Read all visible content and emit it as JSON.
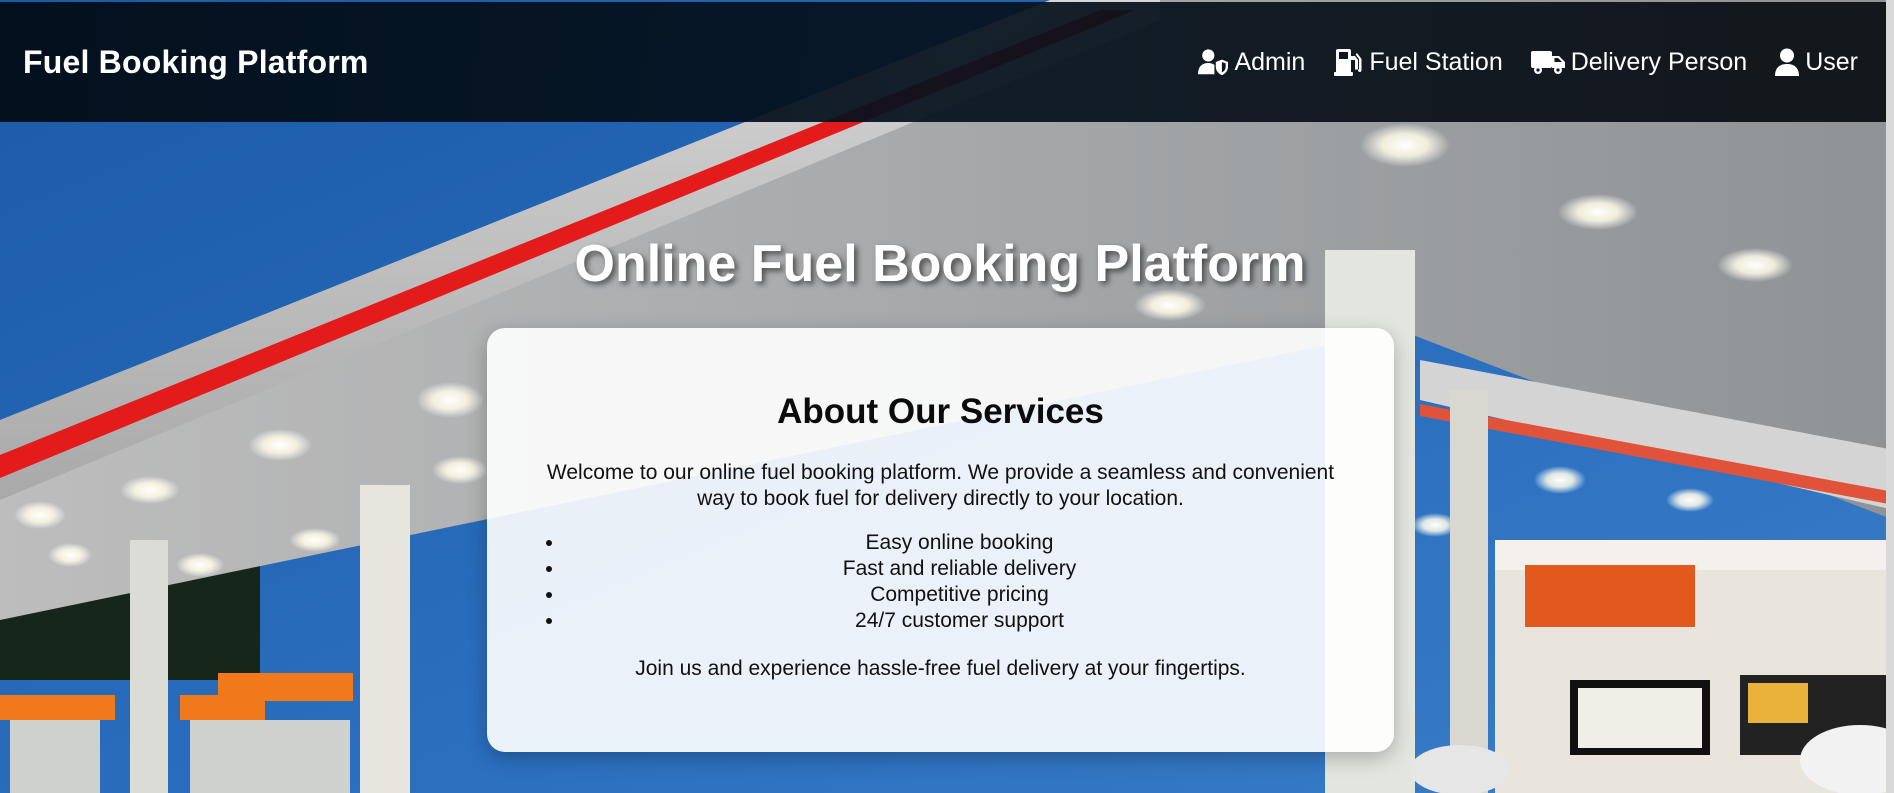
{
  "header": {
    "brand": "Fuel Booking Platform",
    "nav": [
      {
        "label": "Admin",
        "icon": "user-shield-icon"
      },
      {
        "label": "Fuel Station",
        "icon": "gas-pump-icon"
      },
      {
        "label": "Delivery Person",
        "icon": "truck-icon"
      },
      {
        "label": "User",
        "icon": "user-icon"
      }
    ]
  },
  "hero": {
    "title": "Online Fuel Booking Platform"
  },
  "about": {
    "heading": "About Our Services",
    "intro": "Welcome to our online fuel booking platform. We provide a seamless and convenient way to book fuel for delivery directly to your location.",
    "features": [
      "Easy online booking",
      "Fast and reliable delivery",
      "Competitive pricing",
      "24/7 customer support"
    ],
    "closing": "Join us and experience hassle-free fuel delivery at your fingertips."
  },
  "colors": {
    "navbar": "#04111d",
    "accent_red": "#e41b1b",
    "sky": "#1f5fa8",
    "card": "#ffffff"
  }
}
